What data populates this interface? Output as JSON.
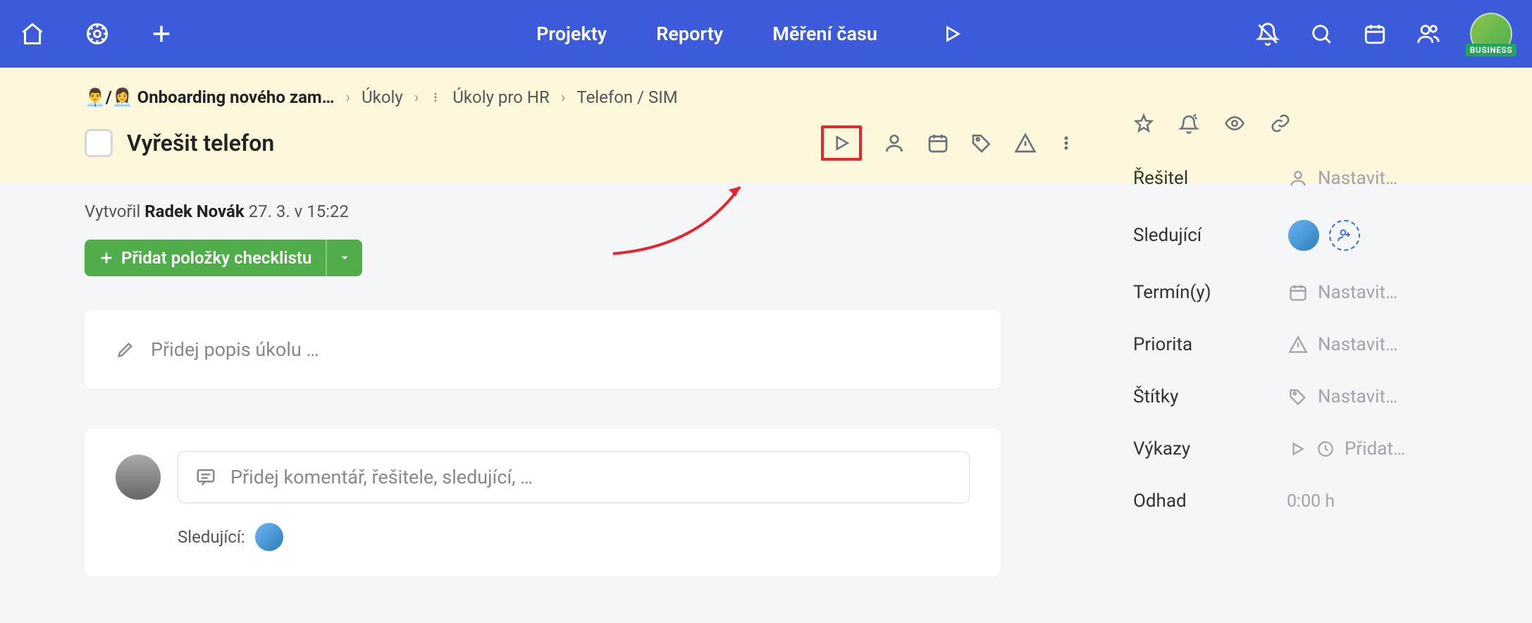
{
  "topnav": {
    "links": {
      "projects": "Projekty",
      "reports": "Reporty",
      "time": "Měření času"
    },
    "badge": "BUSINESS"
  },
  "breadcrumb": {
    "emoji": "👨‍💼/👩‍💼",
    "project": "Onboarding nového zam…",
    "level1": "Úkoly",
    "level2": "Úkoly pro HR",
    "level3": "Telefon / SIM"
  },
  "task": {
    "title": "Vyřešit telefon",
    "created_prefix": "Vytvořil ",
    "created_by": "Radek Novák",
    "created_at": " 27. 3. v 15:22"
  },
  "buttons": {
    "checklist": "Přidat položky checklistu"
  },
  "placeholders": {
    "description": "Přidej popis úkolu …",
    "comment": "Přidej komentář, řešitele, sledující, …"
  },
  "followers_label": "Sledující:",
  "sidebar": {
    "fields": {
      "assignee": "Řešitel",
      "followers": "Sledující",
      "dates": "Termín(y)",
      "priority": "Priorita",
      "tags": "Štítky",
      "timesheets": "Výkazy",
      "estimate": "Odhad"
    },
    "set_label": "Nastavit…",
    "add_label": "Přidat…",
    "estimate_value": "0:00 h"
  }
}
